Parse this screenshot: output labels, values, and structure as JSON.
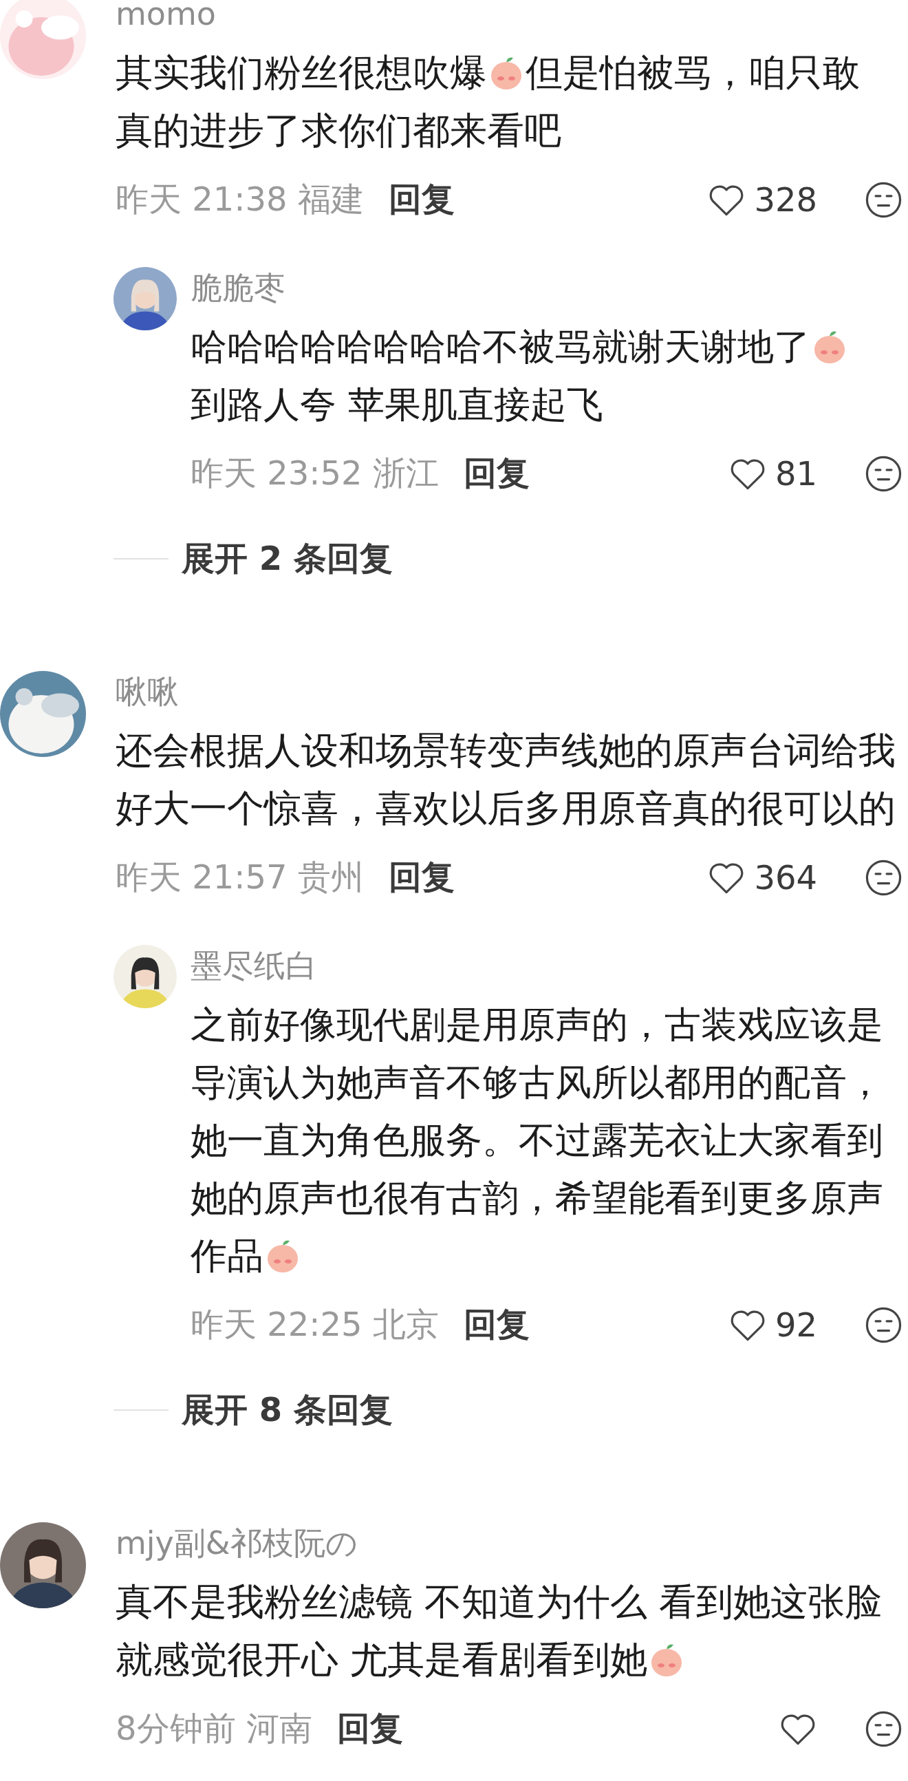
{
  "comments": [
    {
      "author": "momo",
      "avatar": {
        "kind": "picture"
      },
      "lines": [
        [
          {
            "kind": "text",
            "text": "其实我们粉丝很想吹爆"
          },
          {
            "kind": "sticker"
          },
          {
            "kind": "text",
            "text": "但是怕被骂，咱只敢"
          }
        ],
        [
          {
            "kind": "text",
            "text": "真的进步了求你们都来看吧"
          }
        ]
      ],
      "meta": "昨天 21:38 福建",
      "reply_button": "回复",
      "likes": "328",
      "replies": [
        {
          "author": "脆脆枣",
          "avatar": {
            "kind": "picture"
          },
          "lines": [
            [
              {
                "kind": "text",
                "text": "哈哈哈哈哈哈哈哈不被骂就谢天谢地了"
              },
              {
                "kind": "sticker"
              }
            ],
            [
              {
                "kind": "text",
                "text": "到路人夸 苹果肌直接起飞"
              }
            ]
          ],
          "meta": "昨天 23:52 浙江",
          "reply_button": "回复",
          "likes": "81"
        }
      ],
      "expand": "展开 2 条回复"
    },
    {
      "author": "啾啾",
      "avatar": {
        "kind": "picture"
      },
      "lines": [
        [
          {
            "kind": "text",
            "text": "还会根据人设和场景转变声线她的原声台词给我"
          }
        ],
        [
          {
            "kind": "text",
            "text": "好大一个惊喜，喜欢以后多用原音真的很可以的"
          }
        ]
      ],
      "meta": "昨天 21:57 贵州",
      "reply_button": "回复",
      "likes": "364",
      "replies": [
        {
          "author": "墨尽纸白",
          "avatar": {
            "kind": "picture"
          },
          "lines": [
            [
              {
                "kind": "text",
                "text": "之前好像现代剧是用原声的，古装戏应该是"
              }
            ],
            [
              {
                "kind": "text",
                "text": "导演认为她声音不够古风所以都用的配音，"
              }
            ],
            [
              {
                "kind": "text",
                "text": "她一直为角色服务。不过露芜衣让大家看到"
              }
            ],
            [
              {
                "kind": "text",
                "text": "她的原声也很有古韵，希望能看到更多原声"
              }
            ],
            [
              {
                "kind": "text",
                "text": "作品"
              },
              {
                "kind": "sticker"
              }
            ]
          ],
          "meta": "昨天 22:25 北京",
          "reply_button": "回复",
          "likes": "92"
        }
      ],
      "expand": "展开 8 条回复"
    },
    {
      "author": "mjy副&祁枝阮の",
      "avatar": {
        "kind": "picture"
      },
      "lines": [
        [
          {
            "kind": "text",
            "text": "真不是我粉丝滤镜 不知道为什么 看到她这张脸"
          }
        ],
        [
          {
            "kind": "text",
            "text": "就感觉很开心 尤其是看剧看到她"
          },
          {
            "kind": "sticker"
          }
        ]
      ],
      "meta": "8分钟前 河南",
      "reply_button": "回复"
    }
  ]
}
